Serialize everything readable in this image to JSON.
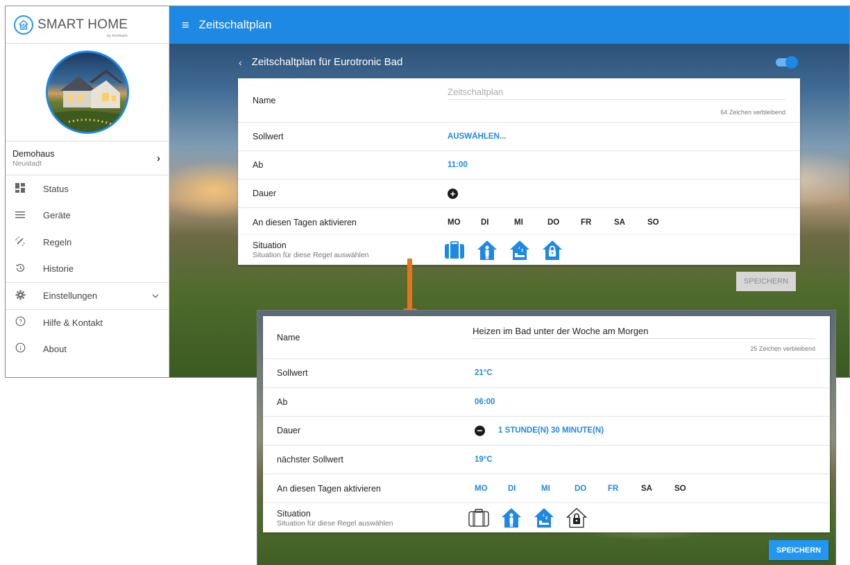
{
  "app": {
    "logo_text": "SMART HOME",
    "logo_sub": "by hornbach",
    "page_title": "Zeitschaltplan"
  },
  "sidebar": {
    "house_name": "Demohaus",
    "house_location": "Neustadt",
    "items": [
      {
        "label": "Status",
        "icon": "dashboard-icon"
      },
      {
        "label": "Geräte",
        "icon": "list-icon"
      },
      {
        "label": "Regeln",
        "icon": "magic-wand-icon"
      },
      {
        "label": "Historie",
        "icon": "history-icon"
      },
      {
        "label": "Einstellungen",
        "icon": "gear-icon"
      },
      {
        "label": "Hilfe & Kontakt",
        "icon": "help-icon"
      },
      {
        "label": "About",
        "icon": "info-icon"
      }
    ]
  },
  "before": {
    "subtitle": "Zeitschaltplan für Eurotronic Bad",
    "toggle_on": true,
    "name_label": "Name",
    "name_placeholder": "Zeitschaltplan",
    "name_counter": "64 Zeichen verbleibend",
    "sollwert_label": "Sollwert",
    "sollwert_value": "AUSWÄHLEN...",
    "ab_label": "Ab",
    "ab_value": "11:00",
    "dauer_label": "Dauer",
    "days_label": "An diesen Tagen aktivieren",
    "days": [
      {
        "label": "MO",
        "active": false
      },
      {
        "label": "DI",
        "active": false
      },
      {
        "label": "MI",
        "active": false
      },
      {
        "label": "DO",
        "active": false
      },
      {
        "label": "FR",
        "active": false
      },
      {
        "label": "SA",
        "active": false
      },
      {
        "label": "SO",
        "active": false
      }
    ],
    "situation_title": "Situation",
    "situation_sub": "Situation für diese Regel auswählen",
    "save_label": "SPEICHERN"
  },
  "after": {
    "name_label": "Name",
    "name_value": "Heizen im Bad unter der Woche am Morgen",
    "name_counter": "25 Zeichen verbleibend",
    "sollwert_label": "Sollwert",
    "sollwert_value": "21°C",
    "ab_label": "Ab",
    "ab_value": "06:00",
    "dauer_label": "Dauer",
    "dauer_value": "1 STUNDE(N) 30 MINUTE(N)",
    "next_label": "nächster Sollwert",
    "next_value": "19°C",
    "days_label": "An diesen Tagen aktivieren",
    "days": [
      {
        "label": "MO",
        "active": true
      },
      {
        "label": "DI",
        "active": true
      },
      {
        "label": "MI",
        "active": true
      },
      {
        "label": "DO",
        "active": true
      },
      {
        "label": "FR",
        "active": true
      },
      {
        "label": "SA",
        "active": false
      },
      {
        "label": "SO",
        "active": false
      }
    ],
    "situation_title": "Situation",
    "situation_sub": "Situation für diese Regel auswählen",
    "save_label": "SPEICHERN"
  },
  "colors": {
    "accent": "#1e88e5",
    "arrow": "#e8731a",
    "save_disabled": "#d6d6d6"
  }
}
